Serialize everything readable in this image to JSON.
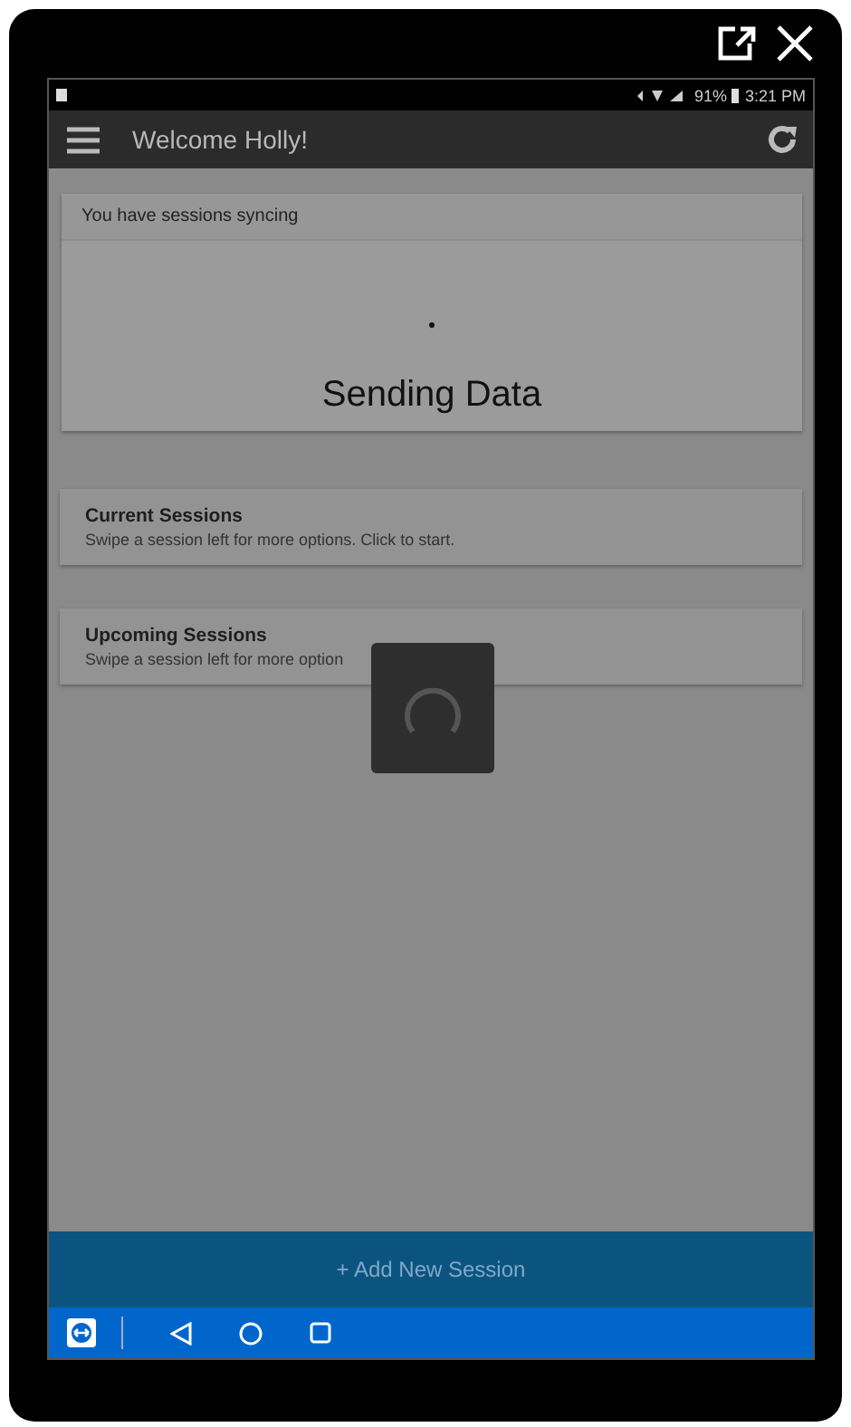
{
  "status_bar": {
    "battery": "91%",
    "time": "3:21 PM"
  },
  "app_bar": {
    "title": "Welcome Holly!"
  },
  "sync_card": {
    "header": "You have sessions syncing",
    "message": "Sending Data"
  },
  "sections": [
    {
      "title": "Current Sessions",
      "hint": "Swipe a session left for more options. Click to start."
    },
    {
      "title": "Upcoming Sessions",
      "hint": "Swipe a session left for more option"
    }
  ],
  "loading": true,
  "add_button": {
    "label": "+ Add New Session",
    "disabled": true
  }
}
